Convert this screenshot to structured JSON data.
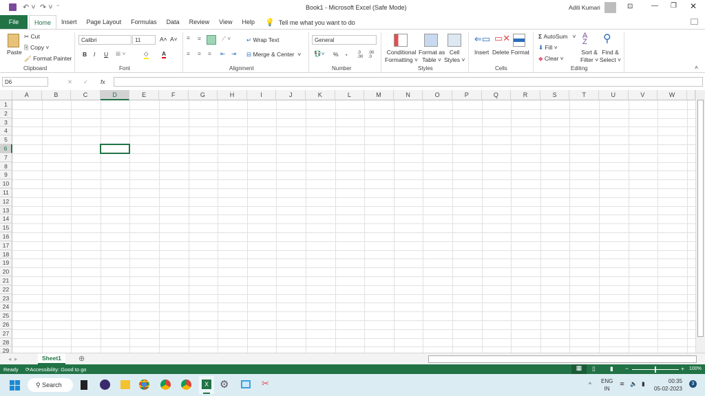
{
  "title": "Book1  -  Microsoft Excel (Safe Mode)",
  "user": "Aditi Kumari",
  "tabs": [
    "File",
    "Home",
    "Insert",
    "Page Layout",
    "Formulas",
    "Data",
    "Review",
    "View",
    "Help"
  ],
  "tell_me": "Tell me what you want to do",
  "clipboard": {
    "paste": "Paste",
    "cut": "Cut",
    "copy": "Copy",
    "format_painter": "Format Painter",
    "label": "Clipboard"
  },
  "font": {
    "name": "Calibri",
    "size": "11",
    "bold": "B",
    "italic": "I",
    "underline": "U",
    "label": "Font"
  },
  "alignment": {
    "wrap": "Wrap Text",
    "merge": "Merge & Center",
    "label": "Alignment"
  },
  "number": {
    "format": "General",
    "percent": "%",
    "comma": ",",
    "label": "Number"
  },
  "styles": {
    "conditional": [
      "Conditional",
      "Formatting"
    ],
    "table": [
      "Format as",
      "Table"
    ],
    "cell": [
      "Cell",
      "Styles"
    ],
    "label": "Styles"
  },
  "cells": {
    "insert": "Insert",
    "delete": "Delete",
    "format": "Format",
    "label": "Cells"
  },
  "editing": {
    "autosum": "AutoSum",
    "fill": "Fill",
    "clear": "Clear",
    "sort": [
      "Sort &",
      "Filter"
    ],
    "find": [
      "Find &",
      "Select"
    ],
    "label": "Editing"
  },
  "formula_bar": {
    "name_box": "D6",
    "fx": "fx",
    "value": ""
  },
  "columns": [
    "A",
    "B",
    "C",
    "D",
    "E",
    "F",
    "G",
    "H",
    "I",
    "J",
    "K",
    "L",
    "M",
    "N",
    "O",
    "P",
    "Q",
    "R",
    "S",
    "T",
    "U",
    "V",
    "W"
  ],
  "rows": [
    "1",
    "2",
    "3",
    "4",
    "5",
    "6",
    "7",
    "8",
    "9",
    "10",
    "11",
    "12",
    "13",
    "14",
    "15",
    "16",
    "17",
    "18",
    "19",
    "20",
    "21",
    "22",
    "23",
    "24",
    "25",
    "26",
    "27",
    "28",
    "29"
  ],
  "selected_cell": "D6",
  "sheet_tab": "Sheet1",
  "status": {
    "ready": "Ready",
    "accessibility": "Accessibility: Good to go",
    "zoom": "100%",
    "zoom_fraction": 0.5
  },
  "taskbar": {
    "search": "Search",
    "lang": [
      "ENG",
      "IN"
    ],
    "time": "00:35",
    "date": "05-02-2023",
    "badge": "3"
  },
  "colors": {
    "accent": "#217346",
    "taskbar": "#dcecf3"
  }
}
